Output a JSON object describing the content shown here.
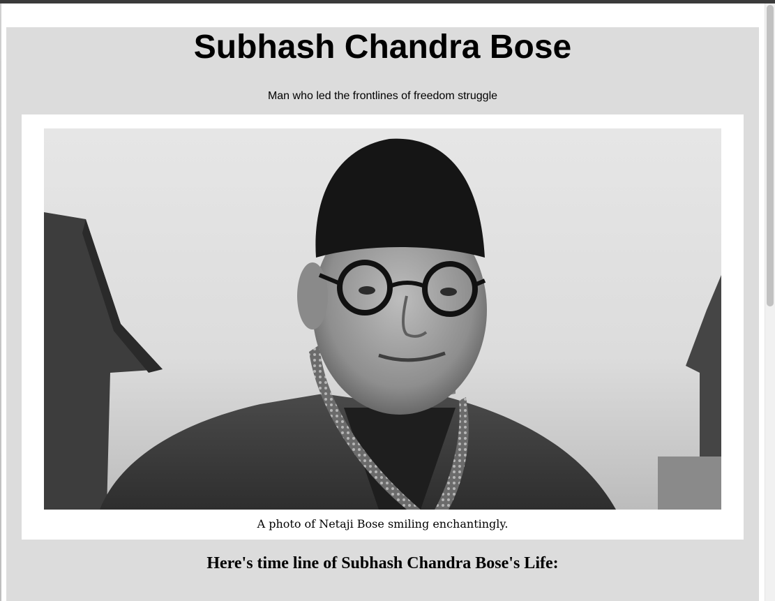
{
  "page": {
    "title": "Subhash Chandra Bose",
    "tagline": "Man who led the frontlines of freedom struggle"
  },
  "figure": {
    "image_description_icon": "portrait-photo",
    "caption": "A photo of Netaji Bose smiling enchantingly."
  },
  "timeline": {
    "heading": "Here's time line of Subhash Chandra Bose's Life:"
  },
  "colors": {
    "main_background": "#dcdcdc",
    "figure_background": "#ffffff",
    "text": "#000000"
  }
}
